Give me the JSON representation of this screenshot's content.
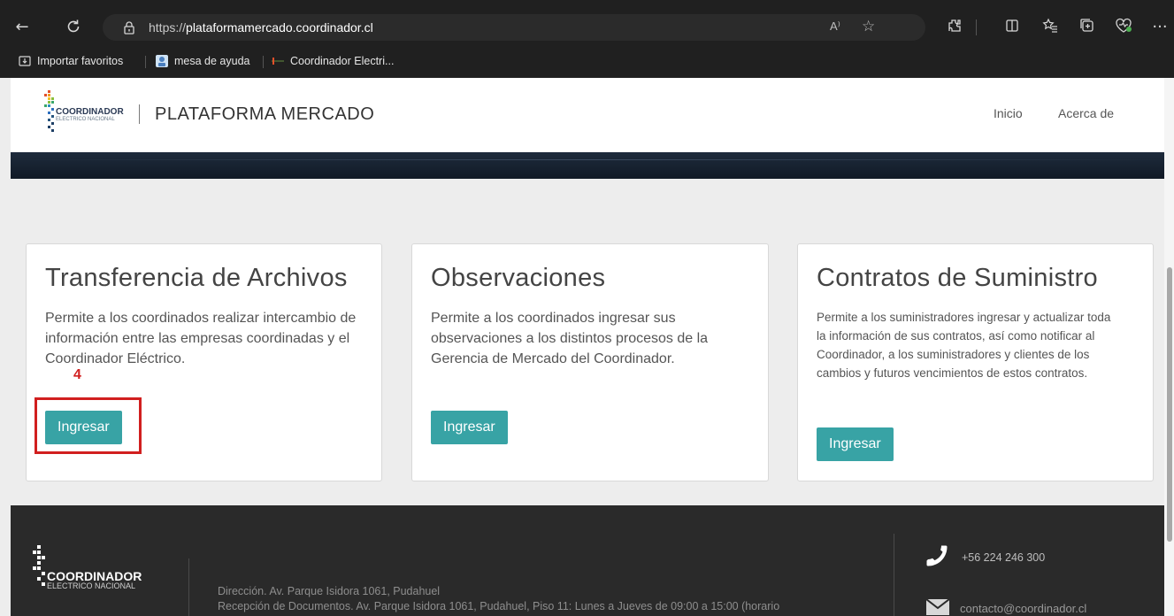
{
  "browser": {
    "url_prefix": "https://",
    "url_domain": "plataformamercado.coordinador.cl",
    "more_glyph": "···",
    "bookmarks": [
      "Importar favoritos",
      "mesa de ayuda",
      "Coordinador Electri..."
    ],
    "read_aloud_glyph": "A⁾"
  },
  "header": {
    "brand_title": "PLATAFORMA MERCADO",
    "nav": [
      "Inicio",
      "Acerca de"
    ],
    "logo_text": "COORDINADOR",
    "logo_subtext": "ELECTRICO NACIONAL"
  },
  "cards": [
    {
      "title": "Transferencia de Archivos",
      "description": "Permite a los coordinados realizar intercambio de información entre las empresas coordinadas y el Coordinador Eléctrico.",
      "button": "Ingresar"
    },
    {
      "title": "Observaciones",
      "description": "Permite a los coordinados ingresar sus observaciones a los distintos procesos de la Gerencia de Mercado del Coordinador.",
      "button": "Ingresar"
    },
    {
      "title": "Contratos de Suministro",
      "description": "Permite a los suministradores ingresar y actualizar toda la información de sus contratos, así como notificar al Coordinador, a los suministradores y clientes de los cambios y futuros vencimientos de estos contratos.",
      "button": "Ingresar"
    }
  ],
  "annotation": {
    "step": "4",
    "color": "#d11f1f"
  },
  "footer": {
    "logo_text": "COORDINADOR",
    "logo_subtext": "ELECTRICO NACIONAL",
    "address": "Dirección. Av. Parque Isidora 1061, Pudahuel",
    "reception": "Recepción de Documentos. Av. Parque Isidora 1061, Pudahuel, Piso 11: Lunes a Jueves de 09:00 a 15:00 (horario",
    "phone": "+56   224 246 300",
    "email": "contacto@coordinador.cl"
  },
  "colors": {
    "accent": "#38a3a5",
    "footer_bg": "#2a2a2a",
    "browser_bg": "#202020"
  }
}
